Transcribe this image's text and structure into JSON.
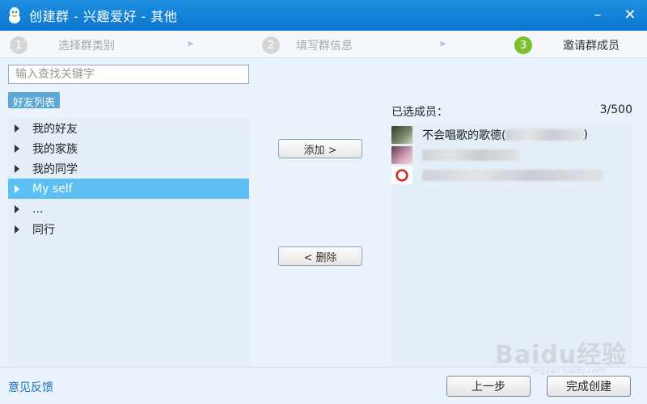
{
  "window": {
    "title": "创建群 - 兴趣爱好 - 其他",
    "controls": {
      "minimize": "–",
      "close": "✕"
    }
  },
  "steps": [
    {
      "num": "1",
      "label": "选择群类别",
      "active": false
    },
    {
      "num": "2",
      "label": "填写群信息",
      "active": false
    },
    {
      "num": "3",
      "label": "邀请群成员",
      "active": true
    }
  ],
  "step_arrow": "➤",
  "search": {
    "placeholder": "输入查找关键字",
    "value": ""
  },
  "friends_tab": "好友列表",
  "tree": [
    {
      "label": "我的好友",
      "selected": false
    },
    {
      "label": "我的家族",
      "selected": false
    },
    {
      "label": "我的同学",
      "selected": false
    },
    {
      "label": "My self",
      "selected": true
    },
    {
      "label": "...",
      "selected": false
    },
    {
      "label": "同行",
      "selected": false
    }
  ],
  "buttons": {
    "add": "添加 >",
    "remove": "< 删除",
    "prev": "上一步",
    "finish": "完成创建"
  },
  "selected": {
    "label": "已选成员：",
    "count": "3/500",
    "members": [
      {
        "name": "不会唱歌的歌德(",
        "suffix": ")",
        "avatar": "photo-avatar"
      },
      {
        "name": "",
        "suffix": "",
        "avatar": "pink-avatar"
      },
      {
        "name": "",
        "suffix": "",
        "avatar": "no-sign-avatar"
      }
    ]
  },
  "footer": {
    "feedback": "意见反馈"
  },
  "watermark": {
    "text": "Baidu经验",
    "sub": "jingyan.baidu.com"
  },
  "colors": {
    "titlebar": "#0b76cf",
    "selected_row": "#5ec0f2",
    "active_step": "#7cc02d"
  }
}
